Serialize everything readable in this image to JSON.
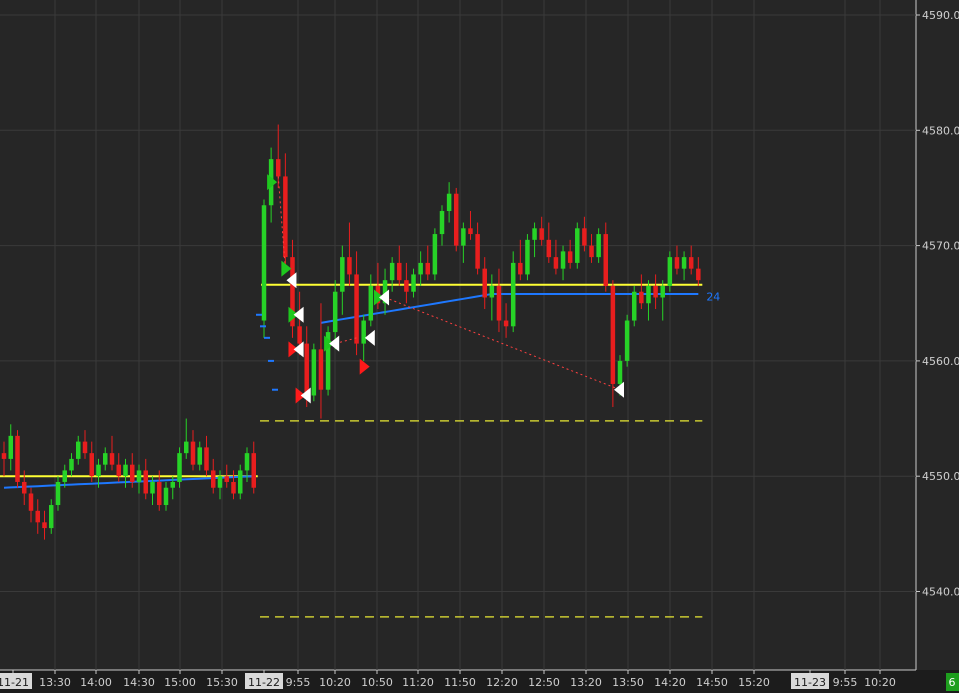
{
  "chart_data": {
    "type": "candlestick",
    "y_axis": {
      "ticks": [
        "4590.00",
        "4580.00",
        "4570.00",
        "4560.00",
        "4550.00",
        "4540.00"
      ],
      "ylim": [
        4532,
        4592
      ]
    },
    "x_axis": {
      "labels": [
        "11-21",
        "13:30",
        "14:00",
        "14:30",
        "15:00",
        "15:30",
        "11-22",
        "9:55",
        "10:20",
        "10:50",
        "11:20",
        "11:50",
        "12:20",
        "12:50",
        "13:20",
        "13:50",
        "14:20",
        "14:50",
        "15:20",
        "11-23",
        "9:55",
        "10:20"
      ],
      "date_labels": [
        "11-21",
        "11-22",
        "11-23"
      ]
    },
    "sessions": [
      {
        "date": "11-21",
        "candles": [
          [
            4552.0,
            4553.0,
            4550.0,
            4551.5
          ],
          [
            4551.5,
            4554.5,
            4550.5,
            4553.5
          ],
          [
            4553.5,
            4554.0,
            4549.0,
            4549.5
          ],
          [
            4549.5,
            4550.5,
            4547.5,
            4548.5
          ],
          [
            4548.5,
            4549.0,
            4546.0,
            4547.0
          ],
          [
            4547.0,
            4548.0,
            4545.0,
            4546.0
          ],
          [
            4546.0,
            4547.0,
            4544.5,
            4545.5
          ],
          [
            4545.5,
            4548.0,
            4545.0,
            4547.5
          ],
          [
            4547.5,
            4550.0,
            4547.0,
            4549.5
          ],
          [
            4549.5,
            4551.0,
            4549.0,
            4550.5
          ],
          [
            4550.5,
            4552.0,
            4550.0,
            4551.5
          ],
          [
            4551.5,
            4553.5,
            4551.0,
            4553.0
          ],
          [
            4553.0,
            4554.0,
            4551.5,
            4552.0
          ],
          [
            4552.0,
            4553.0,
            4549.5,
            4550.0
          ],
          [
            4550.0,
            4551.5,
            4549.0,
            4551.0
          ],
          [
            4551.0,
            4552.5,
            4550.5,
            4552.0
          ],
          [
            4552.0,
            4553.5,
            4550.5,
            4551.0
          ],
          [
            4551.0,
            4552.0,
            4549.5,
            4550.0
          ],
          [
            4550.0,
            4551.5,
            4549.0,
            4551.0
          ],
          [
            4551.0,
            4552.0,
            4549.0,
            4549.5
          ],
          [
            4549.5,
            4551.0,
            4548.5,
            4550.5
          ],
          [
            4550.5,
            4551.5,
            4548.0,
            4548.5
          ],
          [
            4548.5,
            4550.0,
            4547.5,
            4549.5
          ],
          [
            4549.5,
            4550.5,
            4547.0,
            4547.5
          ],
          [
            4547.5,
            4549.5,
            4547.0,
            4549.0
          ],
          [
            4549.0,
            4550.0,
            4548.0,
            4549.5
          ],
          [
            4549.5,
            4552.5,
            4549.0,
            4552.0
          ],
          [
            4552.0,
            4555.0,
            4551.5,
            4553.0
          ],
          [
            4553.0,
            4554.0,
            4550.5,
            4551.0
          ],
          [
            4551.0,
            4553.0,
            4550.5,
            4552.5
          ],
          [
            4552.5,
            4553.5,
            4550.0,
            4550.5
          ],
          [
            4550.5,
            4551.5,
            4548.5,
            4549.0
          ],
          [
            4549.0,
            4550.5,
            4548.0,
            4550.0
          ],
          [
            4550.0,
            4551.0,
            4549.0,
            4549.5
          ],
          [
            4549.5,
            4550.5,
            4548.0,
            4548.5
          ],
          [
            4548.5,
            4551.0,
            4548.0,
            4550.5
          ],
          [
            4550.5,
            4552.5,
            4549.5,
            4552.0
          ],
          [
            4552.0,
            4553.0,
            4548.5,
            4549.0
          ]
        ],
        "vwap": [
          4549.0,
          4550.0
        ],
        "level": 4550.0
      },
      {
        "date": "11-22",
        "candles": [
          [
            4563.5,
            4574.0,
            4562.0,
            4573.5
          ],
          [
            4573.5,
            4578.5,
            4572.0,
            4577.5
          ],
          [
            4577.5,
            4580.5,
            4575.0,
            4576.0
          ],
          [
            4576.0,
            4578.0,
            4568.0,
            4569.0
          ],
          [
            4569.0,
            4570.5,
            4562.0,
            4563.0
          ],
          [
            4563.0,
            4566.0,
            4560.5,
            4561.5
          ],
          [
            4561.5,
            4563.0,
            4556.0,
            4557.0
          ],
          [
            4557.0,
            4561.5,
            4556.5,
            4561.0
          ],
          [
            4561.0,
            4565.0,
            4555.0,
            4557.5
          ],
          [
            4557.5,
            4563.0,
            4557.0,
            4562.5
          ],
          [
            4562.5,
            4567.0,
            4561.0,
            4566.0
          ],
          [
            4566.0,
            4570.0,
            4564.0,
            4569.0
          ],
          [
            4569.0,
            4572.0,
            4566.5,
            4567.5
          ],
          [
            4567.5,
            4569.5,
            4560.5,
            4561.5
          ],
          [
            4561.5,
            4564.0,
            4560.0,
            4563.5
          ],
          [
            4563.5,
            4567.5,
            4563.0,
            4566.5
          ],
          [
            4566.5,
            4568.5,
            4564.5,
            4565.0
          ],
          [
            4565.0,
            4568.0,
            4564.0,
            4567.0
          ],
          [
            4567.0,
            4569.0,
            4566.0,
            4568.5
          ],
          [
            4568.5,
            4570.0,
            4566.5,
            4567.0
          ],
          [
            4567.0,
            4568.5,
            4565.0,
            4566.0
          ],
          [
            4566.0,
            4568.0,
            4565.5,
            4567.5
          ],
          [
            4567.5,
            4569.5,
            4566.5,
            4568.5
          ],
          [
            4568.5,
            4570.0,
            4567.0,
            4567.5
          ],
          [
            4567.5,
            4571.5,
            4567.0,
            4571.0
          ],
          [
            4571.0,
            4573.5,
            4570.0,
            4573.0
          ],
          [
            4573.0,
            4575.5,
            4572.0,
            4574.5
          ],
          [
            4574.5,
            4575.0,
            4569.5,
            4570.0
          ],
          [
            4570.0,
            4572.0,
            4568.5,
            4571.5
          ],
          [
            4571.5,
            4573.0,
            4570.5,
            4571.0
          ],
          [
            4571.0,
            4572.0,
            4567.5,
            4568.0
          ],
          [
            4568.0,
            4569.0,
            4564.5,
            4565.5
          ],
          [
            4565.5,
            4567.5,
            4563.5,
            4566.5
          ],
          [
            4566.5,
            4568.0,
            4562.5,
            4563.5
          ],
          [
            4563.5,
            4565.0,
            4562.0,
            4563.0
          ],
          [
            4563.0,
            4569.5,
            4562.5,
            4568.5
          ],
          [
            4568.5,
            4570.5,
            4567.0,
            4567.5
          ],
          [
            4567.5,
            4571.0,
            4567.0,
            4570.5
          ],
          [
            4570.5,
            4572.0,
            4569.0,
            4571.5
          ],
          [
            4571.5,
            4572.5,
            4570.0,
            4570.5
          ],
          [
            4570.5,
            4572.0,
            4568.5,
            4569.0
          ],
          [
            4569.0,
            4570.5,
            4567.5,
            4568.0
          ],
          [
            4568.0,
            4570.0,
            4567.0,
            4569.5
          ],
          [
            4569.5,
            4570.5,
            4568.0,
            4568.5
          ],
          [
            4568.5,
            4572.0,
            4568.0,
            4571.5
          ],
          [
            4571.5,
            4572.5,
            4569.5,
            4570.0
          ],
          [
            4570.0,
            4571.0,
            4568.5,
            4569.0
          ],
          [
            4569.0,
            4571.5,
            4568.5,
            4571.0
          ],
          [
            4571.0,
            4572.0,
            4566.0,
            4566.5
          ],
          [
            4566.5,
            4567.0,
            4556.0,
            4558.0
          ],
          [
            4558.0,
            4560.5,
            4557.0,
            4560.0
          ],
          [
            4560.0,
            4564.0,
            4559.5,
            4563.5
          ],
          [
            4563.5,
            4566.5,
            4563.0,
            4566.0
          ],
          [
            4566.0,
            4567.5,
            4564.5,
            4565.0
          ],
          [
            4565.0,
            4567.0,
            4563.5,
            4566.5
          ],
          [
            4566.5,
            4567.5,
            4564.5,
            4565.5
          ],
          [
            4565.5,
            4567.0,
            4563.5,
            4566.5
          ],
          [
            4566.5,
            4569.5,
            4566.0,
            4569.0
          ],
          [
            4569.0,
            4570.0,
            4567.5,
            4568.0
          ],
          [
            4568.0,
            4569.5,
            4567.0,
            4569.0
          ],
          [
            4569.0,
            4570.0,
            4567.5,
            4568.0
          ],
          [
            4568.0,
            4569.0,
            4566.5,
            4567.0
          ]
        ],
        "vwap": [
          4564.5,
          4565.8
        ],
        "level": 4566.6,
        "vwap_label": "24"
      }
    ],
    "dashed_levels": [
      4554.8,
      4537.8
    ],
    "colors": {
      "background": "#262626",
      "grid": "#3a3a3a",
      "up": "#27d327",
      "down": "#e81e1e",
      "vwap": "#1e78ff",
      "level": "#ffff33",
      "dashed_level": "#c8c832",
      "marker_white": "#ffffff",
      "marker_red": "#ff1a1a",
      "marker_green": "#1ec81e",
      "dotted_red": "#ff4040"
    },
    "markers": [
      {
        "t": 1,
        "price": 4575.5,
        "color": "green",
        "dir": "right"
      },
      {
        "t": 3,
        "price": 4568.0,
        "color": "green",
        "dir": "right"
      },
      {
        "t": 4,
        "price": 4567.0,
        "color": "white",
        "dir": "left"
      },
      {
        "t": 4,
        "price": 4564.0,
        "color": "green",
        "dir": "right"
      },
      {
        "t": 5,
        "price": 4564.0,
        "color": "white",
        "dir": "left"
      },
      {
        "t": 4,
        "price": 4561.0,
        "color": "red",
        "dir": "right"
      },
      {
        "t": 5,
        "price": 4561.0,
        "color": "white",
        "dir": "left"
      },
      {
        "t": 5,
        "price": 4557.0,
        "color": "red",
        "dir": "right"
      },
      {
        "t": 6,
        "price": 4557.0,
        "color": "white",
        "dir": "left"
      },
      {
        "t": 9,
        "price": 4561.5,
        "color": "green",
        "dir": "right"
      },
      {
        "t": 10,
        "price": 4561.5,
        "color": "white",
        "dir": "left"
      },
      {
        "t": 14,
        "price": 4559.5,
        "color": "red",
        "dir": "right"
      },
      {
        "t": 15,
        "price": 4562.0,
        "color": "white",
        "dir": "left"
      },
      {
        "t": 16,
        "price": 4565.5,
        "color": "green",
        "dir": "right"
      },
      {
        "t": 17,
        "price": 4565.5,
        "color": "white",
        "dir": "left"
      },
      {
        "t": 50,
        "price": 4557.5,
        "color": "white",
        "dir": "left"
      }
    ],
    "stops": [
      4564.0,
      4563.0,
      4562.0,
      4560.0,
      4557.5
    ],
    "dotted_lines": [
      {
        "t0": 2,
        "p0": 4576.0,
        "t1": 3,
        "p1": 4568.0
      },
      {
        "t0": 10,
        "p0": 4561.5,
        "t1": 13,
        "p1": 4562.0
      },
      {
        "t0": 17,
        "p0": 4565.5,
        "t1": 50,
        "p1": 4557.5
      }
    ],
    "corner_badge": "6"
  }
}
